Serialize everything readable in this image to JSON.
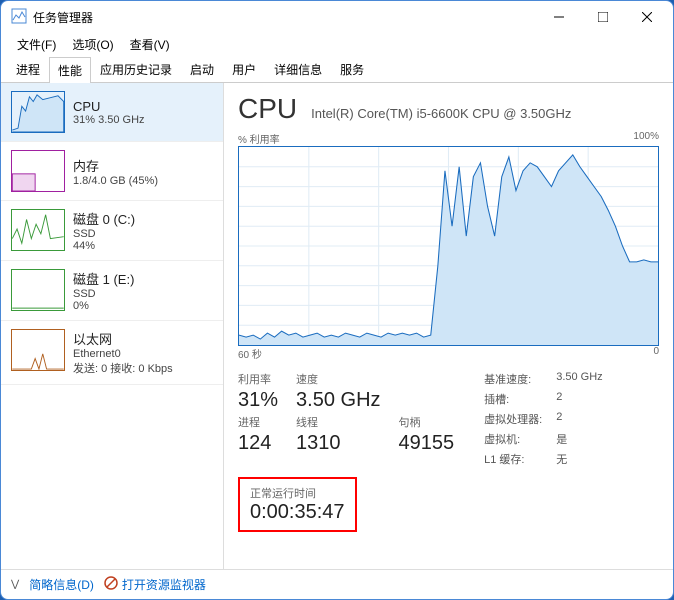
{
  "window": {
    "title": "任务管理器"
  },
  "menu": {
    "file": "文件(F)",
    "options": "选项(O)",
    "view": "查看(V)"
  },
  "tabs": {
    "processes": "进程",
    "performance": "性能",
    "appHistory": "应用历史记录",
    "startup": "启动",
    "users": "用户",
    "details": "详细信息",
    "services": "服务"
  },
  "sidebar": {
    "cpu": {
      "title": "CPU",
      "sub": "31% 3.50 GHz"
    },
    "memory": {
      "title": "内存",
      "sub": "1.8/4.0 GB (45%)"
    },
    "disk0": {
      "title": "磁盘 0 (C:)",
      "sub": "SSD",
      "sub2": "44%"
    },
    "disk1": {
      "title": "磁盘 1 (E:)",
      "sub": "SSD",
      "sub2": "0%"
    },
    "ethernet": {
      "title": "以太网",
      "sub": "Ethernet0",
      "sub2": "发送: 0 接收: 0 Kbps"
    }
  },
  "main": {
    "title": "CPU",
    "model": "Intel(R) Core(TM) i5-6600K CPU @ 3.50GHz",
    "chart": {
      "topLeft": "% 利用率",
      "topRight": "100%",
      "bottomLeft": "60 秒",
      "bottomRight": "0"
    },
    "stats": {
      "utilLabel": "利用率",
      "utilVal": "31%",
      "speedLabel": "速度",
      "speedVal": "3.50 GHz",
      "procLabel": "进程",
      "procVal": "124",
      "threadLabel": "线程",
      "threadVal": "1310",
      "handleLabel": "句柄",
      "handleVal": "49155"
    },
    "side": {
      "baseLabel": "基准速度:",
      "baseVal": "3.50 GHz",
      "socketLabel": "插槽:",
      "socketVal": "2",
      "vprocLabel": "虚拟处理器:",
      "vprocVal": "2",
      "vmLabel": "虚拟机:",
      "vmVal": "是",
      "l1Label": "L1 缓存:",
      "l1Val": "无"
    },
    "uptime": {
      "label": "正常运行时间",
      "value": "0:00:35:47"
    }
  },
  "footer": {
    "brief": "简略信息(D)",
    "resmon": "打开资源监视器"
  },
  "chart_data": {
    "type": "line",
    "title": "% 利用率",
    "ylim": [
      0,
      100
    ],
    "xrange_seconds": 60,
    "values": [
      5,
      4,
      5,
      3,
      6,
      4,
      7,
      5,
      6,
      4,
      5,
      6,
      4,
      5,
      4,
      6,
      5,
      4,
      6,
      5,
      4,
      6,
      5,
      6,
      5,
      6,
      4,
      5,
      40,
      88,
      60,
      90,
      55,
      85,
      92,
      70,
      55,
      85,
      95,
      78,
      88,
      92,
      90,
      85,
      80,
      88,
      92,
      96,
      90,
      85,
      80,
      75,
      68,
      60,
      50,
      42,
      42,
      43,
      42,
      42
    ]
  }
}
